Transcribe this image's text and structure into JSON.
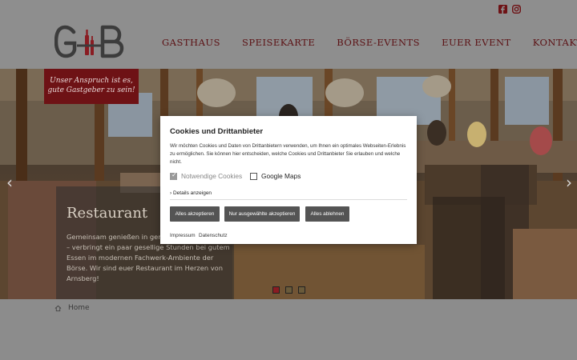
{
  "header": {
    "social": [
      {
        "name": "facebook-icon"
      },
      {
        "name": "instagram-icon"
      }
    ],
    "logo_text": "GB",
    "nav": [
      "GASTHAUS",
      "SPEISEKARTE",
      "BÖRSE-EVENTS",
      "EUER EVENT",
      "KONTAKT"
    ]
  },
  "hero": {
    "slogan_line1": "Unser Anspruch ist es,",
    "slogan_line2": "gute Gastgeber zu sein!",
    "title": "Restaurant",
    "text": "Gemeinsam genießen in gemütlicher Atmosphäre – verbringt ein paar gesellige Stunden bei gutem Essen im modernen Fachwerk-Ambiente der Börse. Wir sind euer Restaurant im Herzen von Arnsberg!",
    "slides": 3,
    "active_slide": 1,
    "arrow_left": "‹",
    "arrow_right": "›"
  },
  "breadcrumb": {
    "home_label": "Home"
  },
  "cookie": {
    "title": "Cookies und Drittanbieter",
    "text": "Wir möchten Cookies und Daten von Drittanbietern verwenden, um Ihnen ein optimales Webseiten-Erlebnis zu ermöglichen. Sie können hier entscheiden, welche Cookies und Drittanbieter Sie erlauben und welche nicht.",
    "necessary_label": "Notwendige Cookies",
    "necessary_checked": true,
    "maps_label": "Google Maps",
    "maps_checked": false,
    "details_label": "Details anzeigen",
    "btn_accept_all": "Alles akzeptieren",
    "btn_accept_selected": "Nur ausgewählte akzeptieren",
    "btn_reject": "Alles ablehnen",
    "link_imprint": "Impressum",
    "link_privacy": "Datenschutz"
  },
  "colors": {
    "brand": "#6e1215",
    "nav_text": "#5b1013",
    "button": "#545454"
  }
}
